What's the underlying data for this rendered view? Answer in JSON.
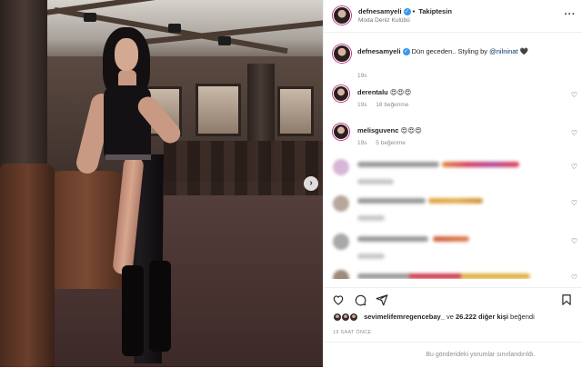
{
  "post": {
    "author": "defnesamyeli",
    "follow_status": "Takiptesin",
    "separator": "•",
    "location": "Moda Deniz Kulübü"
  },
  "caption": {
    "username": "defnesamyeli",
    "text": "Dün geceden.. Styling by ",
    "mention": "@nilninat",
    "emoji": "🖤",
    "time": "19s"
  },
  "comments": [
    {
      "username": "derentalu",
      "text": "😍😍😍",
      "time": "19s",
      "likes": "18 beğenme"
    },
    {
      "username": "melisguvenc",
      "text": "😍😍😍",
      "time": "19s",
      "likes": "5 beğenme"
    }
  ],
  "footer": {
    "liker": "sevimelifemregencebay_",
    "likes_text": " ve ",
    "likes_count": "26.222 diğer kişi",
    "likes_suffix": " beğendi",
    "timestamp": "19 SAAT ÖNCE",
    "limited_notice": "Bu gönderideki yorumlar sınırlandırıldı."
  },
  "icons": {
    "verified": "verified-icon",
    "more": "more-options-icon",
    "next": "chevron-right-icon",
    "like": "heart-icon",
    "comment": "comment-icon",
    "share": "share-icon",
    "save": "bookmark-icon"
  },
  "colors": {
    "verified": "#3897f0",
    "link": "#00376b",
    "muted": "#8e8e8e",
    "border": "#efefef"
  }
}
